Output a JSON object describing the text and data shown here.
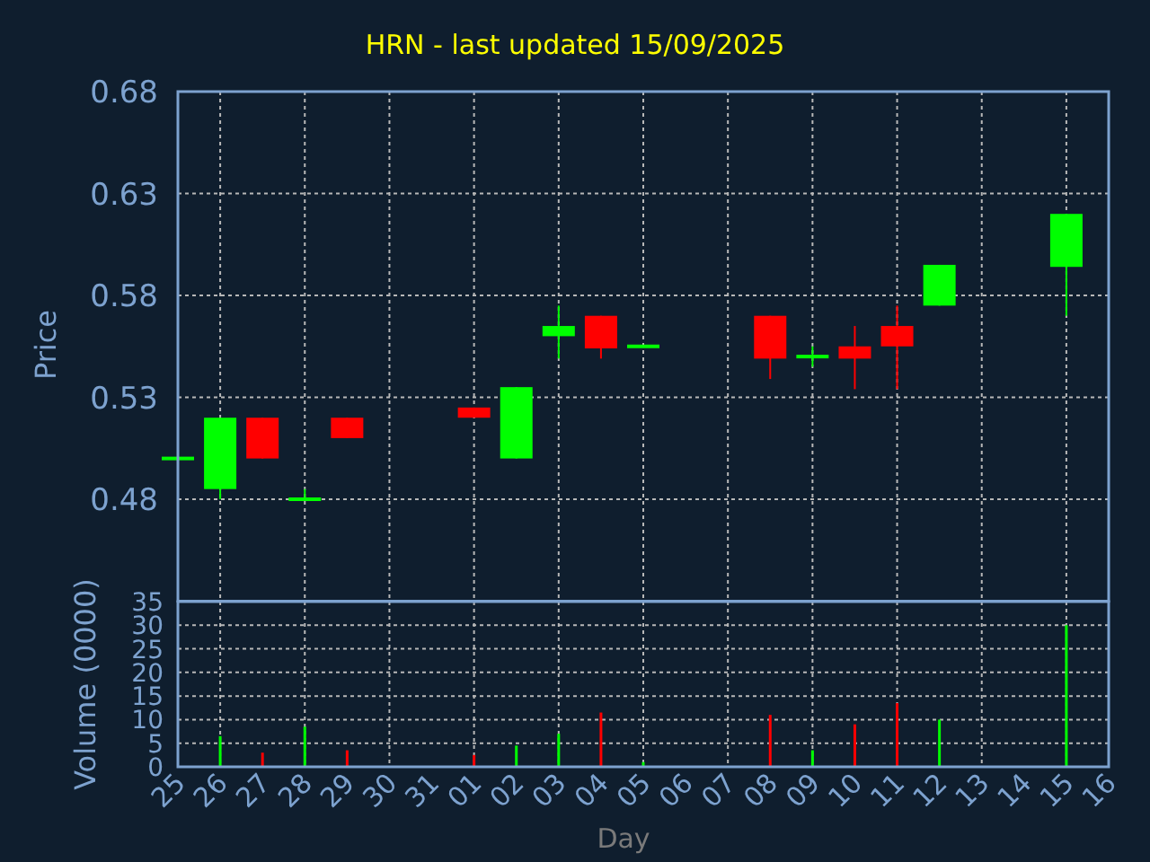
{
  "title": "HRN - last updated 15/09/2025",
  "price_chart": {
    "ylabel": "Price",
    "yticks": [
      "0.68",
      "0.63",
      "0.58",
      "0.53",
      "0.48"
    ]
  },
  "volume_chart": {
    "chart_data": {
      "type": "bar",
      "grid": true,
      "xlabel": "Day",
      "ylabel": "Volume (0000)",
      "categories": [
        "25",
        "26",
        "27",
        "28",
        "29",
        "30",
        "31",
        "01",
        "02",
        "03",
        "04",
        "05",
        "06",
        "07",
        "08",
        "09",
        "10",
        "11",
        "12",
        "13",
        "14",
        "15",
        "16"
      ],
      "ylim": [
        0,
        35
      ],
      "yticks": [
        0,
        5,
        10,
        15,
        20,
        25,
        30,
        35
      ],
      "series": [
        {
          "color": "#00ff00",
          "values": [
            null,
            6.5,
            null,
            8.5,
            null,
            null,
            null,
            null,
            4.5,
            7,
            null,
            1,
            null,
            null,
            null,
            3.5,
            null,
            null,
            10,
            null,
            null,
            30,
            null
          ]
        },
        {
          "color": "#ff0000",
          "values": [
            null,
            null,
            3,
            null,
            3.5,
            null,
            null,
            2.5,
            null,
            null,
            11.5,
            null,
            null,
            null,
            11,
            null,
            9,
            13.5,
            null,
            null,
            null,
            null,
            null
          ]
        }
      ]
    }
  }
}
